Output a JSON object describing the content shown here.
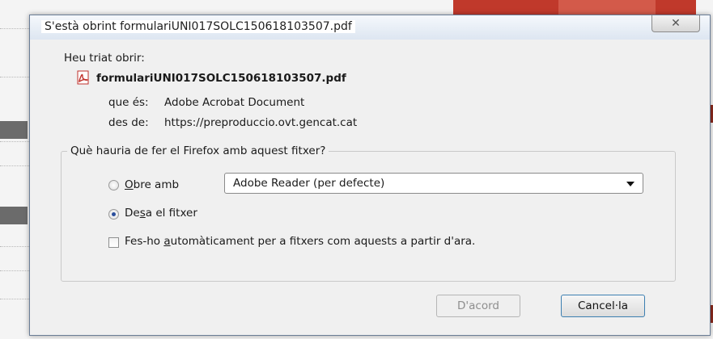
{
  "dialog": {
    "title": "S'està obrint formulariUNI017SOLC150618103507.pdf",
    "close_glyph": "✕",
    "chosen_label": "Heu triat obrir:",
    "file_name": "formulariUNI017SOLC150618103507.pdf",
    "type_label": "que és:",
    "type_value": "Adobe Acrobat Document",
    "from_label": "des de:",
    "from_value": "https://preproduccio.ovt.gencat.cat",
    "question": "Què hauria de fer el Firefox amb aquest fitxer?",
    "open_with_prefix": "",
    "open_with_accel": "O",
    "open_with_rest": "bre amb",
    "app_select_value": "Adobe Reader  (per defecte)",
    "save_prefix": "De",
    "save_accel": "s",
    "save_rest": "a el fitxer",
    "auto_prefix": "Fes-ho ",
    "auto_accel": "a",
    "auto_rest": "utomàticament per a fitxers com aquests a partir d'ara.",
    "ok_label": "D'acord",
    "cancel_label": "Cancel·la",
    "open_with_selected": false,
    "save_selected": true,
    "auto_checked": false
  },
  "icons": {
    "file_type": "pdf-icon",
    "close": "close-icon",
    "dropdown": "chevron-down-icon"
  },
  "colors": {
    "pdf_icon": "#c0312b",
    "radio_dot": "#2a4e9c",
    "default_button_border": "#3c7fb1"
  }
}
